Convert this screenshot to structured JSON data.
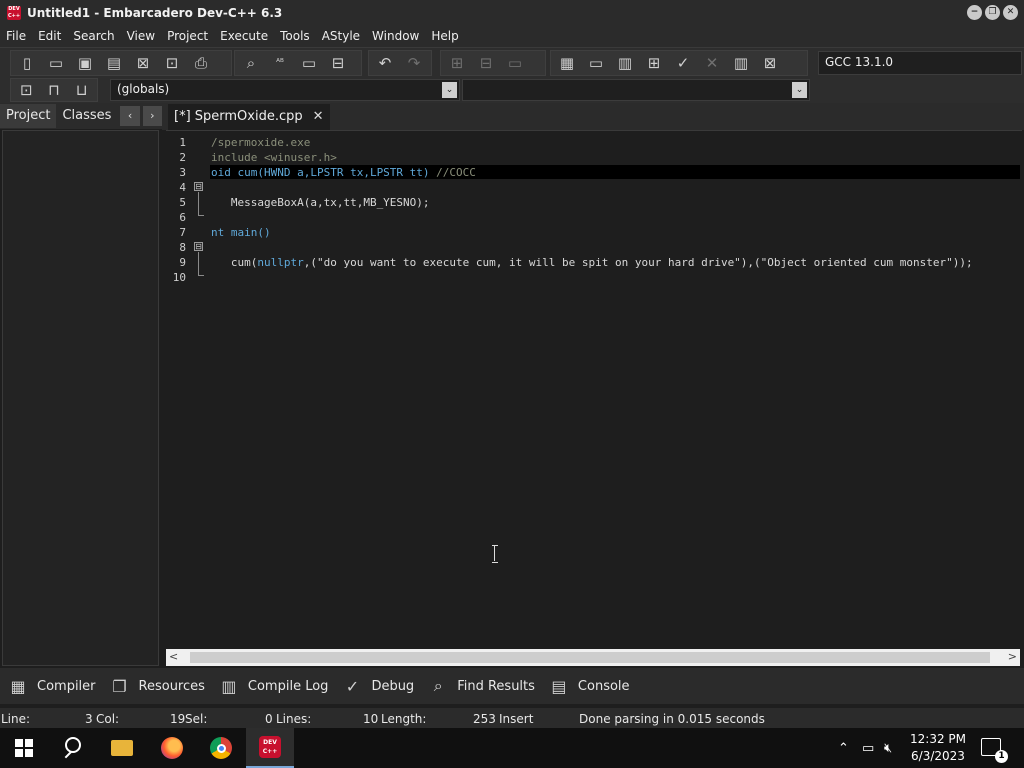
{
  "window": {
    "title": "Untitled1 - Embarcadero Dev-C++ 6.3",
    "logo_text": "DEV C++",
    "controls": [
      "−",
      "❐",
      "✕"
    ]
  },
  "menu": [
    "File",
    "Edit",
    "Search",
    "View",
    "Project",
    "Execute",
    "Tools",
    "AStyle",
    "Window",
    "Help"
  ],
  "toolbar": {
    "compiler": "GCC 13.1.0",
    "scope": "(globals)",
    "scope_arrow": "⌄",
    "member_arrow": "⌄"
  },
  "left_panel": {
    "tabs": [
      "Project",
      "Classes"
    ],
    "prev": "‹",
    "next": "›"
  },
  "editor": {
    "tab_label": "[*] SpermOxide.cpp",
    "tab_close": "✕",
    "line_numbers": [
      "1",
      "2",
      "3",
      "4",
      "5",
      "6",
      "7",
      "8",
      "9",
      "10"
    ],
    "lines": [
      {
        "number": "1",
        "segments": [
          {
            "text": "/spermoxide.exe",
            "style": "comment"
          }
        ]
      },
      {
        "number": "2",
        "segments": [
          {
            "text": "include <winuser.h>",
            "style": "comment"
          }
        ]
      },
      {
        "number": "3",
        "segments": [
          {
            "text": "oid cum(HWND a,LPSTR tx,LPSTR tt) ",
            "style": "kw"
          },
          {
            "text": "//COCC",
            "style": "comment"
          }
        ]
      },
      {
        "number": "4",
        "segments": [
          {
            "text": "",
            "style": "normal"
          }
        ]
      },
      {
        "number": "5",
        "segments": [
          {
            "text": "   MessageBoxA(a,tx,tt,MB_YESNO);",
            "style": "normal"
          }
        ]
      },
      {
        "number": "6",
        "segments": [
          {
            "text": "",
            "style": "normal"
          }
        ]
      },
      {
        "number": "7",
        "segments": [
          {
            "text": "nt main()",
            "style": "kw"
          }
        ]
      },
      {
        "number": "8",
        "segments": [
          {
            "text": "",
            "style": "normal"
          }
        ]
      },
      {
        "number": "9",
        "segments": [
          {
            "text": "   cum(",
            "style": "normal"
          },
          {
            "text": "nullptr",
            "style": "kw"
          },
          {
            "text": ",(\"do you want to execute cum, it will be spit on your hard drive\"),(\"Object oriented cum monster\"));",
            "style": "normal"
          }
        ]
      },
      {
        "number": "10",
        "segments": [
          {
            "text": "",
            "style": "normal"
          }
        ]
      }
    ],
    "fold_marks": [
      "⊟",
      "⊟"
    ],
    "scroll_left": "<",
    "scroll_right": ">"
  },
  "bottom_tabs": [
    {
      "label": "Compiler",
      "icon": "grid-icon",
      "glyph": "▦"
    },
    {
      "label": "Resources",
      "icon": "resources-icon",
      "glyph": "❐"
    },
    {
      "label": "Compile Log",
      "icon": "bar-chart-icon",
      "glyph": "▥"
    },
    {
      "label": "Debug",
      "icon": "check-icon",
      "glyph": "✓"
    },
    {
      "label": "Find Results",
      "icon": "find-icon",
      "glyph": "⌕"
    },
    {
      "label": "Console",
      "icon": "console-icon",
      "glyph": "▤"
    }
  ],
  "status": {
    "line_label": "Line:",
    "line_value": "3",
    "col_label": "Col:",
    "col_value": "19",
    "sel_label": "Sel:",
    "sel_value": "0",
    "lines_label": "Lines:",
    "lines_value": "10",
    "length_label": "Length:",
    "length_value": "253",
    "mode": "Insert",
    "message": "Done parsing in 0.015 seconds"
  },
  "taskbar": {
    "time": "12:32 PM",
    "date": "6/3/2023",
    "tray_chevron": "⌃",
    "notification_count": "1",
    "devcpp_text": "DEV C++"
  }
}
